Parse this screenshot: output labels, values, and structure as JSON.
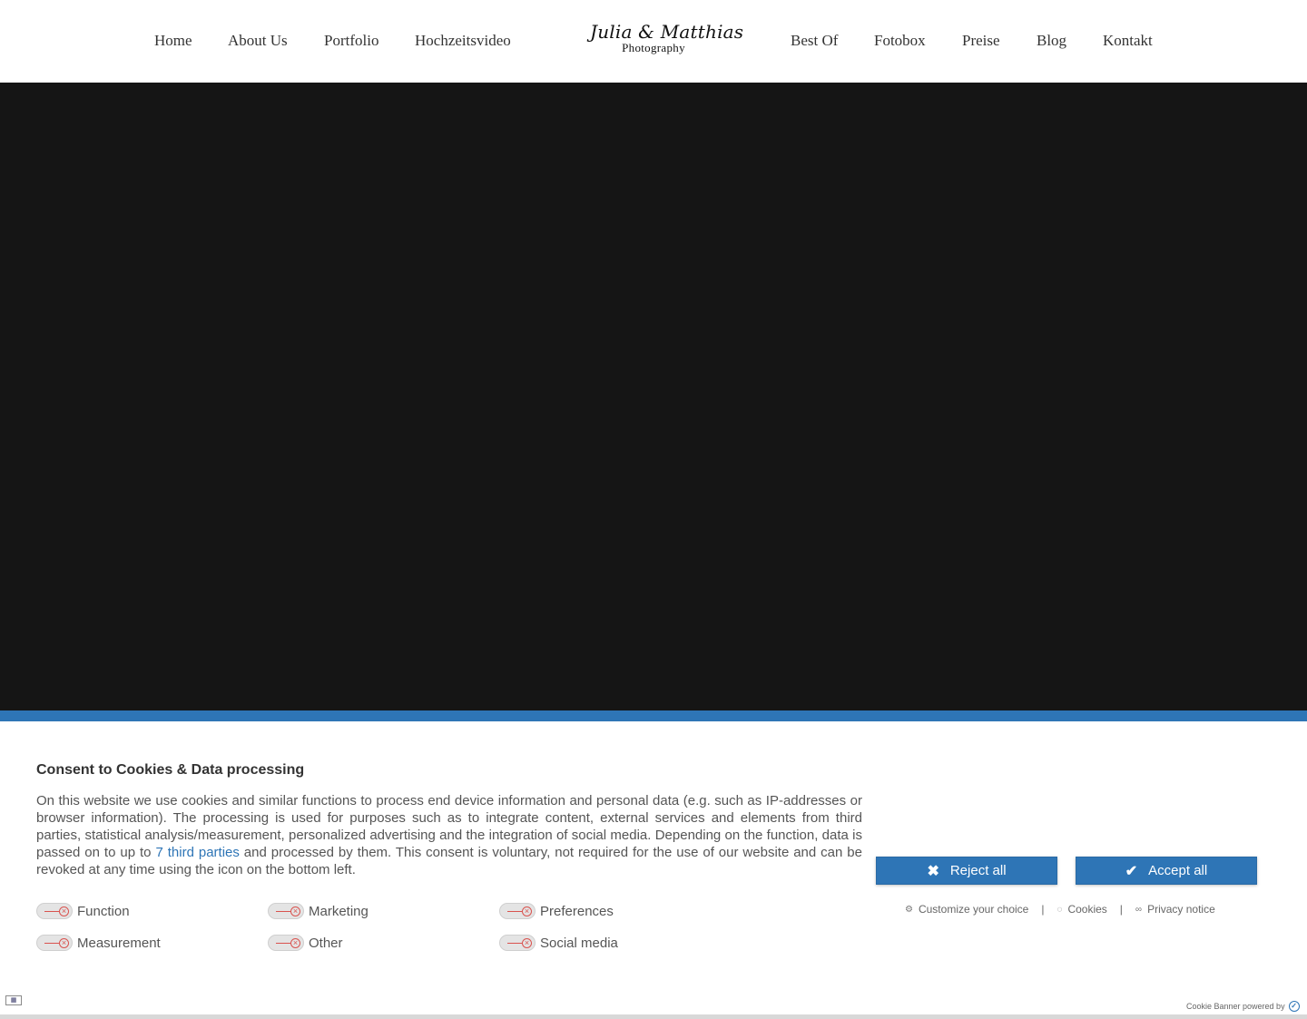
{
  "nav": {
    "left": [
      "Home",
      "About Us",
      "Portfolio",
      "Hochzeitsvideo"
    ],
    "right": [
      "Best Of",
      "Fotobox",
      "Preise",
      "Blog",
      "Kontakt"
    ]
  },
  "logo": {
    "script": "Julia & Matthias",
    "sub": "Photography"
  },
  "consent": {
    "title": "Consent to Cookies & Data processing",
    "text_before": "On this website we use cookies and similar functions to process end device information and personal data (e.g. such as IP-addresses or browser information). The processing is used for purposes such as to integrate content, external services and elements from third parties, statistical analysis/measurement, personalized advertising and the integration of social media. Depending on the function, data is passed on to up to ",
    "link_text": "7 third parties",
    "text_after": " and processed by them. This consent is voluntary, not required for the use of our website and can be revoked at any time using the icon on the bottom left.",
    "categories": [
      "Function",
      "Marketing",
      "Preferences",
      "Measurement",
      "Other",
      "Social media"
    ],
    "reject_label": "Reject all",
    "accept_label": "Accept all",
    "customize_label": "Customize your choice",
    "cookies_label": "Cookies",
    "privacy_label": "Privacy notice",
    "separator": "|",
    "powered_by": "Cookie Banner powered by"
  },
  "icons": {
    "reject": "close-icon",
    "accept": "check-icon",
    "customize": "gear-icon",
    "cookies": "cookie-icon",
    "privacy": "link-icon",
    "language": "language-flag-icon",
    "toggle_off": "toggle-off-icon"
  },
  "colors": {
    "accent": "#2e75b6",
    "hero": "#151515",
    "toggle_off": "#d9534f",
    "text": "#555555"
  }
}
